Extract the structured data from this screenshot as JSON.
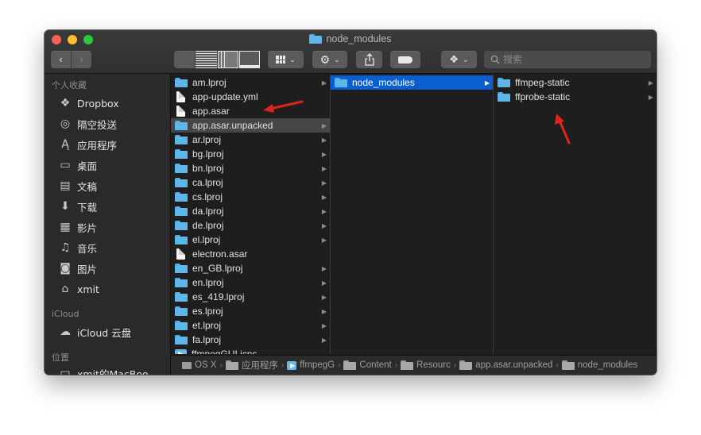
{
  "window": {
    "title": "node_modules"
  },
  "toolbar": {
    "back": "‹",
    "forward": "›"
  },
  "search": {
    "placeholder": "搜索"
  },
  "sidebar": {
    "favorites_header": "个人收藏",
    "favorites": [
      {
        "label": "Dropbox",
        "icon": "dropbox-icon",
        "glyph": "❖"
      },
      {
        "label": "隔空投送",
        "icon": "airdrop-icon",
        "glyph": "◎"
      },
      {
        "label": "应用程序",
        "icon": "applications-icon",
        "glyph": "Ą"
      },
      {
        "label": "桌面",
        "icon": "desktop-icon",
        "glyph": "▭"
      },
      {
        "label": "文稿",
        "icon": "documents-icon",
        "glyph": "▤"
      },
      {
        "label": "下载",
        "icon": "downloads-icon",
        "glyph": "⬇"
      },
      {
        "label": "影片",
        "icon": "movies-icon",
        "glyph": "▦"
      },
      {
        "label": "音乐",
        "icon": "music-icon",
        "glyph": "♫"
      },
      {
        "label": "图片",
        "icon": "pictures-icon",
        "glyph": "◙"
      },
      {
        "label": "xmit",
        "icon": "home-icon",
        "glyph": "⌂"
      }
    ],
    "icloud_header": "iCloud",
    "icloud": [
      {
        "label": "iCloud 云盘",
        "icon": "cloud-icon",
        "glyph": "☁"
      }
    ],
    "locations_header": "位置",
    "locations": [
      {
        "label": "xmit的MacBoo",
        "icon": "laptop-icon",
        "glyph": "▭"
      }
    ]
  },
  "columns": {
    "col1": [
      {
        "name": "am.lproj",
        "kind": "folder",
        "arrow": true
      },
      {
        "name": "app-update.yml",
        "kind": "yml",
        "arrow": false
      },
      {
        "name": "app.asar",
        "kind": "file",
        "arrow": false
      },
      {
        "name": "app.asar.unpacked",
        "kind": "folder",
        "arrow": true,
        "selected": "grey"
      },
      {
        "name": "ar.lproj",
        "kind": "folder",
        "arrow": true
      },
      {
        "name": "bg.lproj",
        "kind": "folder",
        "arrow": true
      },
      {
        "name": "bn.lproj",
        "kind": "folder",
        "arrow": true
      },
      {
        "name": "ca.lproj",
        "kind": "folder",
        "arrow": true
      },
      {
        "name": "cs.lproj",
        "kind": "folder",
        "arrow": true
      },
      {
        "name": "da.lproj",
        "kind": "folder",
        "arrow": true
      },
      {
        "name": "de.lproj",
        "kind": "folder",
        "arrow": true
      },
      {
        "name": "el.lproj",
        "kind": "folder",
        "arrow": true
      },
      {
        "name": "electron.asar",
        "kind": "file",
        "arrow": false
      },
      {
        "name": "en_GB.lproj",
        "kind": "folder",
        "arrow": true
      },
      {
        "name": "en.lproj",
        "kind": "folder",
        "arrow": true
      },
      {
        "name": "es_419.lproj",
        "kind": "folder",
        "arrow": true
      },
      {
        "name": "es.lproj",
        "kind": "folder",
        "arrow": true
      },
      {
        "name": "et.lproj",
        "kind": "folder",
        "arrow": true
      },
      {
        "name": "fa.lproj",
        "kind": "folder",
        "arrow": true
      },
      {
        "name": "ffmpegGUI.icns",
        "kind": "icns",
        "arrow": false
      }
    ],
    "col2": [
      {
        "name": "node_modules",
        "kind": "folder",
        "arrow": true,
        "selected": "blue"
      }
    ],
    "col3": [
      {
        "name": "ffmpeg-static",
        "kind": "folder",
        "arrow": true
      },
      {
        "name": "ffprobe-static",
        "kind": "folder",
        "arrow": true
      }
    ]
  },
  "pathbar": {
    "segments": [
      {
        "label": "OS X",
        "icon": "hd-icon"
      },
      {
        "label": "应用程序",
        "icon": "folder-icon"
      },
      {
        "label": "ffmpegG",
        "icon": "app-icon"
      },
      {
        "label": "Content",
        "icon": "folder-icon"
      },
      {
        "label": "Resourc",
        "icon": "folder-icon"
      },
      {
        "label": "app.asar.unpacked",
        "icon": "folder-icon"
      },
      {
        "label": "node_modules",
        "icon": "folder-icon"
      }
    ]
  },
  "colors": {
    "selection_blue": "#0a5fd0",
    "selection_grey": "#464646",
    "folder_blue": "#5fb6e8",
    "annotation_red": "#e0241b"
  }
}
